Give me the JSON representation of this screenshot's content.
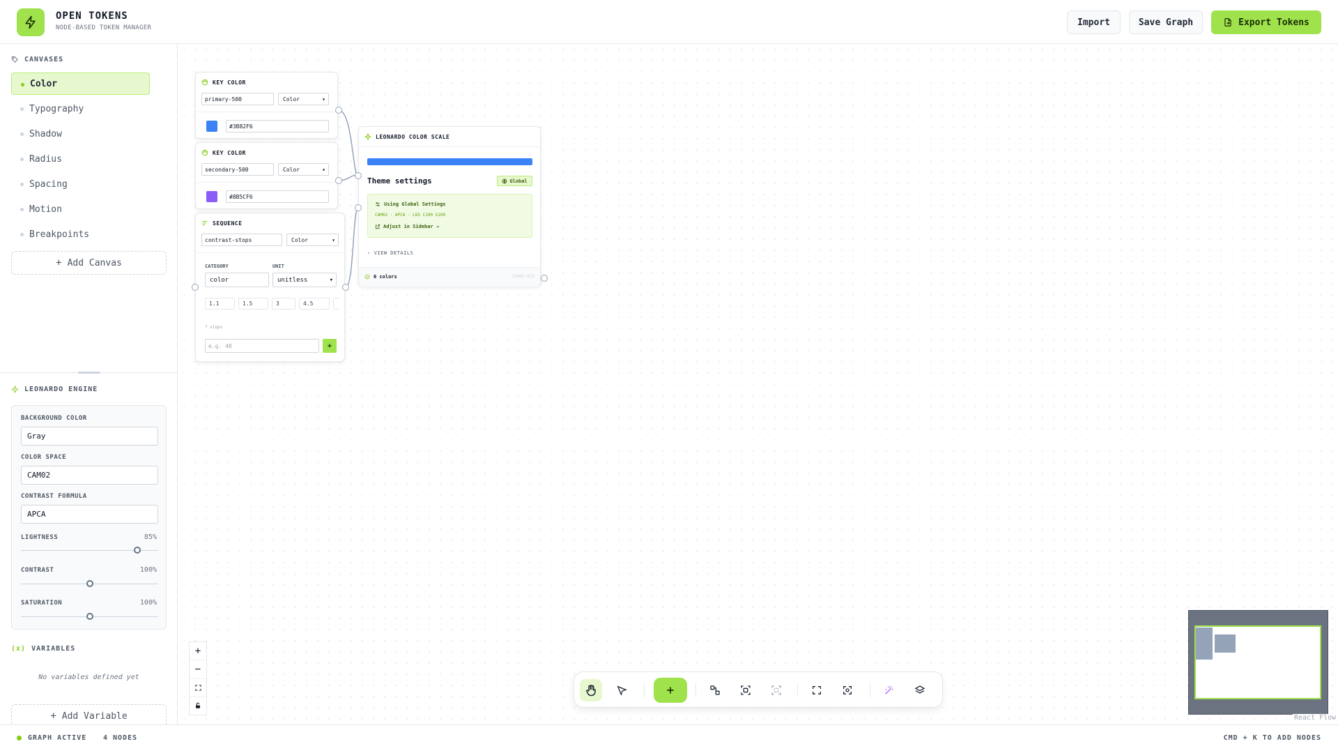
{
  "header": {
    "title": "OPEN TOKENS",
    "subtitle": "NODE-BASED TOKEN MANAGER",
    "import_label": "Import",
    "save_label": "Save Graph",
    "export_label": "Export Tokens"
  },
  "sidebar": {
    "canvases_title": "CANVASES",
    "canvases": [
      {
        "label": "Color",
        "active": true
      },
      {
        "label": "Typography"
      },
      {
        "label": "Shadow"
      },
      {
        "label": "Radius"
      },
      {
        "label": "Spacing"
      },
      {
        "label": "Motion"
      },
      {
        "label": "Breakpoints"
      }
    ],
    "add_canvas_label": "Add Canvas",
    "engine": {
      "title": "LEONARDO ENGINE",
      "background_label": "BACKGROUND COLOR",
      "background_value": "Gray",
      "color_space_label": "COLOR SPACE",
      "color_space_value": "CAM02",
      "contrast_formula_label": "CONTRAST FORMULA",
      "contrast_formula_value": "APCA",
      "lightness_label": "LIGHTNESS",
      "lightness_value": "85%",
      "lightness_level": 0.85,
      "contrast_label": "CONTRAST",
      "contrast_value": "100%",
      "contrast_level": 0.5,
      "saturation_label": "SATURATION",
      "saturation_value": "100%",
      "saturation_level": 0.5
    },
    "variables_title": "VARIABLES",
    "no_variables": "No variables defined yet",
    "add_variable_label": "Add Variable"
  },
  "nodes": {
    "key1": {
      "title": "KEY COLOR",
      "name": "primary-500",
      "type": "Color",
      "hex": "#3B82F6",
      "swatch": "#3B82F6"
    },
    "key2": {
      "title": "KEY COLOR",
      "name": "secondary-500",
      "type": "Color",
      "hex": "#8B5CF6",
      "swatch": "#8B5CF6"
    },
    "sequence": {
      "title": "SEQUENCE",
      "name": "contrast-stops",
      "type": "Color",
      "category_label": "CATEGORY",
      "category_value": "color",
      "unit_label": "UNIT",
      "unit_value": "unitless",
      "stops": [
        "1.1",
        "1.5",
        "3",
        "4.5",
        ""
      ],
      "stops_count": "7 stops",
      "add_placeholder": "e.g. 48",
      "add_btn": "+"
    },
    "scale": {
      "title": "LEONARDO COLOR SCALE",
      "bar_color": "#3B82F6",
      "theme_settings": "Theme settings",
      "badge": "Global",
      "using_global": "Using Global Settings",
      "details": "CAM02 · APCA · L85 C100 S100",
      "adjust_link": "Adjust in Sidebar →",
      "view_details": "VIEW DETAILS",
      "colors_count": "0 colors",
      "space": "CAM02-UCS"
    }
  },
  "canvas": {
    "attribution": "React Flow"
  },
  "status": {
    "state": "GRAPH ACTIVE",
    "nodes": "4 NODES",
    "hint": "CMD + K TO ADD NODES"
  },
  "colors": {
    "accent": "#9FE24B",
    "accent_light": "#E7F8CF",
    "purple_icon": "#A855F7"
  }
}
